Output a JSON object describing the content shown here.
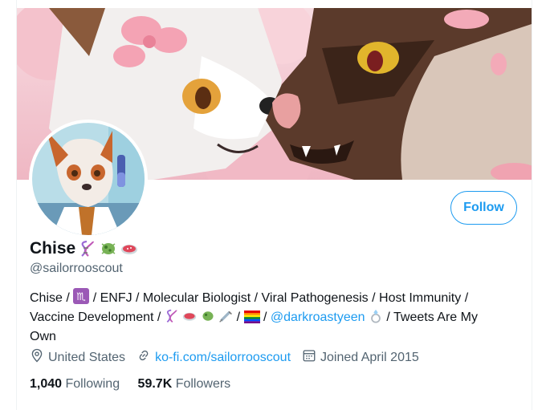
{
  "profile": {
    "display_name": "Chise",
    "handle": "@sailorrooscout",
    "follow_label": "Follow",
    "name_emojis": [
      "dna-icon",
      "microbe-icon",
      "petri-dish-icon"
    ]
  },
  "bio": {
    "line1_a": "Chise /",
    "line1_b": "/ ENFJ / Molecular Biologist / Viral Pathogenesis / Host Immunity /",
    "line2_a": "Vaccine Development /",
    "line2_b": "/",
    "line2_c": "/",
    "mention": "@darkroastyeen",
    "line2_d": "/ Tweets Are My",
    "line3": "Own",
    "icons": [
      "scorpio-icon",
      "dna-icon",
      "petri-dish-icon",
      "microbe-icon",
      "syringe-icon",
      "rainbow-flag-icon",
      "ring-icon"
    ]
  },
  "meta": {
    "location": "United States",
    "website": "ko-fi.com/sailorrooscout",
    "joined": "Joined April 2015"
  },
  "stats": {
    "following_count": "1,040",
    "following_label": "Following",
    "followers_count": "59.7K",
    "followers_label": "Followers"
  },
  "colors": {
    "accent": "#1d9bf0",
    "secondary_text": "#536471",
    "banner_pink": "#f3c7cf"
  }
}
